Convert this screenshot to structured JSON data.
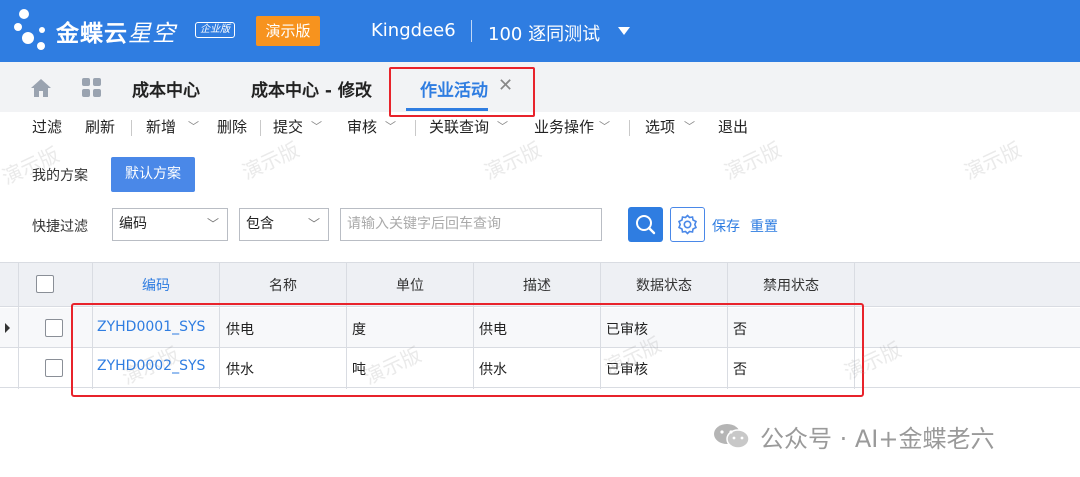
{
  "header": {
    "brand_main": "金蝶云",
    "brand_sub": "星空",
    "edition": "企业版",
    "demo_tag": "演示版",
    "tenant": "Kingdee6",
    "org": "100  逐同测试"
  },
  "tabs": [
    {
      "label": "成本中心"
    },
    {
      "label": "成本中心 - 修改"
    },
    {
      "label": "作业活动"
    }
  ],
  "toolbar": {
    "items": [
      "过滤",
      "刷新",
      "新增",
      "删除",
      "提交",
      "审核",
      "关联查询",
      "业务操作",
      "选项",
      "退出"
    ]
  },
  "filter": {
    "scheme_label": "我的方案",
    "scheme_button": "默认方案",
    "quick_label": "快捷过滤",
    "field_select": "编码",
    "operator_select": "包含",
    "search_placeholder": "请输入关键字后回车查询",
    "save_link": "保存",
    "reset_link": "重置"
  },
  "table": {
    "columns": [
      "编码",
      "名称",
      "单位",
      "描述",
      "数据状态",
      "禁用状态"
    ],
    "rows": [
      {
        "code": "ZYHD0001_SYS",
        "name": "供电",
        "unit": "度",
        "desc": "供电",
        "data_status": "已审核",
        "disabled": "否"
      },
      {
        "code": "ZYHD0002_SYS",
        "name": "供水",
        "unit": "吨",
        "desc": "供水",
        "data_status": "已审核",
        "disabled": "否"
      }
    ]
  },
  "watermark_text": "演示版",
  "credit": "公众号 · AI+金蝶老六",
  "colors": {
    "primary": "#2f7de1",
    "demo_orange": "#f7931e",
    "highlight_red": "#e8232b"
  }
}
